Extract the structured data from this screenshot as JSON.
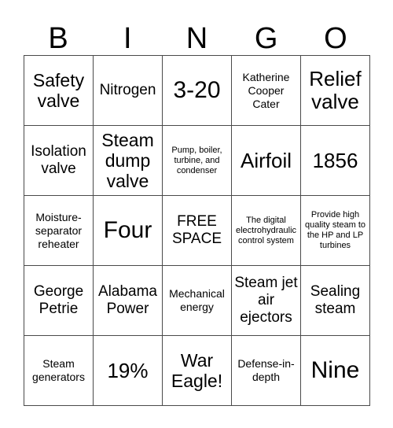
{
  "card": {
    "header_letters": [
      "B",
      "I",
      "N",
      "G",
      "O"
    ],
    "rows": [
      [
        {
          "text": "Safety valve",
          "size": "lg"
        },
        {
          "text": "Nitrogen",
          "size": "md"
        },
        {
          "text": "3-20",
          "size": "xxl"
        },
        {
          "text": "Katherine Cooper Cater",
          "size": "sm"
        },
        {
          "text": "Relief valve",
          "size": "xl"
        }
      ],
      [
        {
          "text": "Isolation valve",
          "size": "md"
        },
        {
          "text": "Steam dump valve",
          "size": "lg"
        },
        {
          "text": "Pump, boiler, turbine, and condenser",
          "size": "xs"
        },
        {
          "text": "Airfoil",
          "size": "xl"
        },
        {
          "text": "1856",
          "size": "xl"
        }
      ],
      [
        {
          "text": "Moisture-separator reheater",
          "size": "sm"
        },
        {
          "text": "Four",
          "size": "xxl"
        },
        {
          "text": "FREE SPACE",
          "size": "md"
        },
        {
          "text": "The digital electrohydraulic control system",
          "size": "xs"
        },
        {
          "text": "Provide high quality steam to the HP and LP turbines",
          "size": "xs"
        }
      ],
      [
        {
          "text": "George Petrie",
          "size": "md"
        },
        {
          "text": "Alabama Power",
          "size": "md"
        },
        {
          "text": "Mechanical energy",
          "size": "sm"
        },
        {
          "text": "Steam jet air ejectors",
          "size": "md"
        },
        {
          "text": "Sealing steam",
          "size": "md"
        }
      ],
      [
        {
          "text": "Steam generators",
          "size": "sm"
        },
        {
          "text": "19%",
          "size": "xl"
        },
        {
          "text": "War Eagle!",
          "size": "lg"
        },
        {
          "text": "Defense-in-depth",
          "size": "sm"
        },
        {
          "text": "Nine",
          "size": "xxl"
        }
      ]
    ]
  },
  "colors": {
    "background": "#ffffff",
    "text": "#000000",
    "grid_line": "#4a4a4a"
  }
}
